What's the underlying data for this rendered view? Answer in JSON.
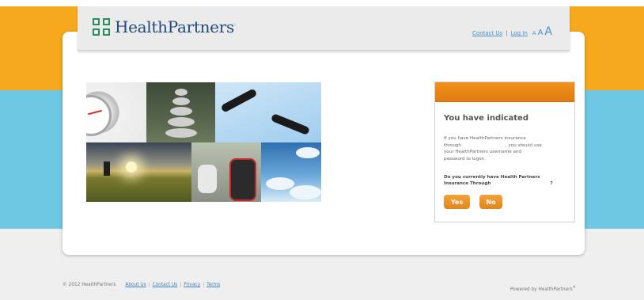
{
  "header": {
    "brand": "HealthPartners",
    "brand_mark": "·",
    "links": {
      "contact": "Contact Us",
      "separator": "|",
      "login": "Log In"
    },
    "font_size_small": "A",
    "font_size_medium": "A",
    "font_size_large": "A"
  },
  "panel": {
    "title": "You have indicated",
    "body_line1": "If you have HealthPartners insurance",
    "body_line2_prefix": "through",
    "body_line2_suffix": ", you should use",
    "body_line3": "your HealthPartners username and",
    "body_line4": "password to logon.",
    "question_line1": "Do you currently have Health Partners",
    "question_line2": "Insurance Through",
    "question_mark": "?",
    "yes_label": "Yes",
    "no_label": "No"
  },
  "footer": {
    "copyright": "© 2012 HealthPartners",
    "links": [
      "About Us",
      "Contact Us",
      "Privacy",
      "Terms"
    ],
    "separator": "|",
    "powered_by": "Powered by HealthPartners",
    "powered_mark": "®"
  },
  "colors": {
    "orange": "#f7a91d",
    "blue": "#6ec8e3",
    "brand_blue": "#1f4a7a",
    "brand_green": "#2a8c5a",
    "button_orange": "#e0861c"
  },
  "icons": [
    "healthpartners-logo-icon"
  ]
}
